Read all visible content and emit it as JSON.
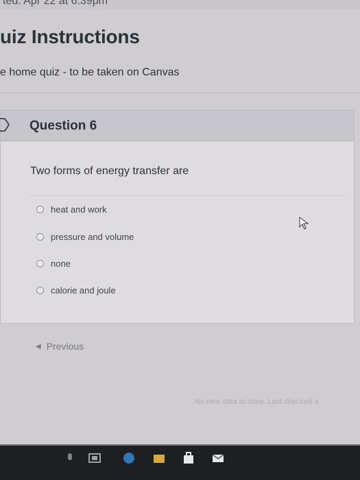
{
  "header": {
    "due_line": "ted. Apr 22 at 6:39pm",
    "title": "uiz Instructions",
    "description": "e home quiz - to be taken on Canvas"
  },
  "question": {
    "title": "Question 6",
    "text": "Two forms of energy transfer are",
    "answers": [
      {
        "label": "heat and work"
      },
      {
        "label": "pressure and volume"
      },
      {
        "label": "none"
      },
      {
        "label": "calorie and joule"
      }
    ]
  },
  "navigation": {
    "previous_label": "Previous"
  },
  "status": {
    "save_text": "No new data to save. Last checked a"
  },
  "icons": {
    "flag": "flag-icon",
    "cursor": "mouse-pointer-icon",
    "previous": "chevron-left-icon"
  },
  "colors": {
    "header_band": "#c7c6cc",
    "card_bg": "#dedcde",
    "taskbar": "#1e1f22"
  }
}
